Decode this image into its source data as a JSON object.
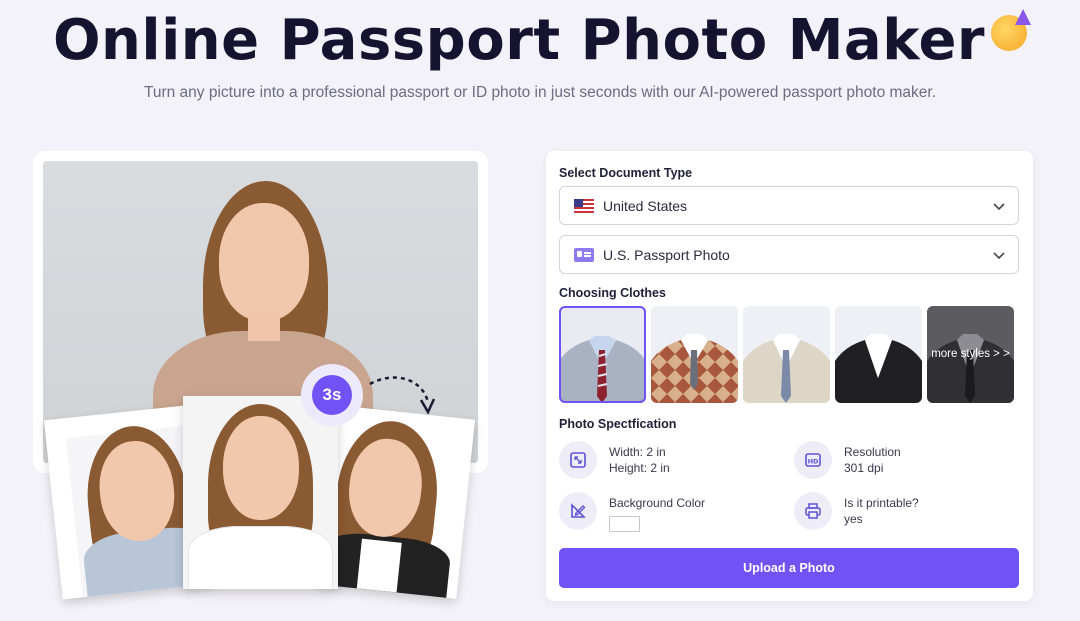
{
  "hero": {
    "title": "Online Passport Photo Maker",
    "subtitle": "Turn any picture into a professional passport or ID photo in just seconds with our AI-powered passport photo maker."
  },
  "demo": {
    "timer_badge": "3s"
  },
  "panel": {
    "document_type_label": "Select Document Type",
    "country_select": {
      "value": "United States",
      "icon": "us-flag-icon"
    },
    "document_select": {
      "value": "U.S. Passport Photo",
      "icon": "id-card-icon"
    },
    "clothes_label": "Choosing Clothes",
    "clothes_options": [
      {
        "name": "blue-suit-striped-tie",
        "selected": true
      },
      {
        "name": "argyle-sweater-vest",
        "selected": false
      },
      {
        "name": "beige-suit-blue-tie",
        "selected": false
      },
      {
        "name": "black-suit-white-shirt",
        "selected": false
      },
      {
        "name": "dark-suit",
        "selected": false,
        "overlay": "more styles > >"
      }
    ],
    "spec_label": "Photo Spectfication",
    "specs": {
      "size": {
        "line1": "Width: 2 in",
        "line2": "Height: 2 in",
        "icon": "resize-icon"
      },
      "resolution": {
        "line1": "Resolution",
        "line2": "301 dpi",
        "icon": "hd-icon"
      },
      "background": {
        "line1": "Background Color",
        "color": "#ffffff",
        "icon": "pencil-ruler-icon"
      },
      "printable": {
        "line1": "Is it printable?",
        "line2": "yes",
        "icon": "printer-icon"
      }
    },
    "upload_button": "Upload a Photo"
  },
  "colors": {
    "accent": "#6f53f5",
    "background": "#f3f2f8",
    "title": "#161330"
  }
}
